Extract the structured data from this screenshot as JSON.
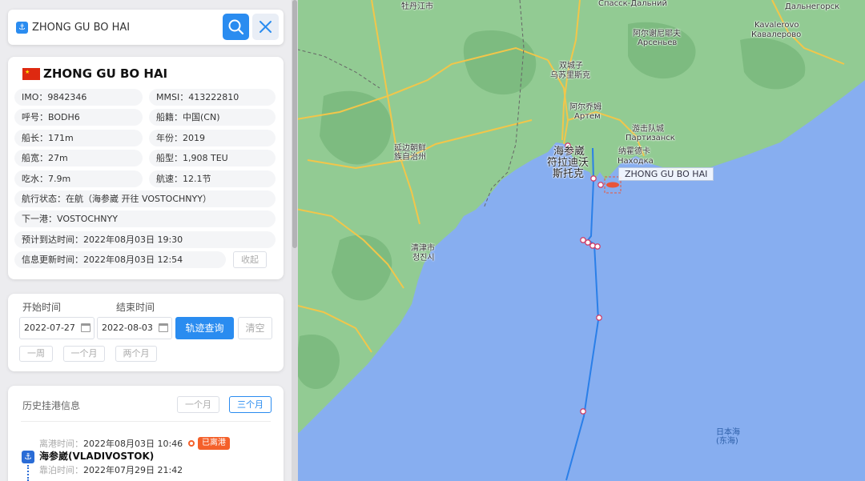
{
  "search": {
    "value": "ZHONG GU BO HAI",
    "placeholder": ""
  },
  "ship": {
    "name": "ZHONG GU BO HAI",
    "flag": "CN",
    "imo": "IMO：9842346",
    "mmsi": "MMSI：413222810",
    "callsign": "呼号：BODH6",
    "registry": "船籍：中国(CN)",
    "length": "船长：171m",
    "year": "年份：2019",
    "width": "船宽：27m",
    "type": "船型：1,908 TEU",
    "draft": "吃水：7.9m",
    "speed": "航速：12.1节",
    "status": "航行状态：在航（海参崴 开往 VOSTOCHNYY）",
    "next_port": "下一港：VOSTOCHNYY",
    "eta": "预计到达时间：2022年08月03日 19:30",
    "updated": "信息更新时间：2022年08月03日 12:54",
    "collapse_label": "收起"
  },
  "track": {
    "start_label": "开始时间",
    "end_label": "结束时间",
    "start_date": "2022-07-27",
    "end_date": "2022-08-03",
    "query_label": "轨迹查询",
    "clear_label": "清空",
    "quick": [
      "一周",
      "一个月",
      "两个月"
    ]
  },
  "history": {
    "title": "历史挂港信息",
    "one_month": "一个月",
    "three_month": "三个月",
    "entry": {
      "depart_key": "离港时间：",
      "depart_time": "2022年08月03日 10:46",
      "badge": "已离港",
      "port": "海参崴(VLADIVOSTOK)",
      "berth_key": "靠泊时间：",
      "berth_time": "2022年07月29日 21:42"
    }
  },
  "map": {
    "labels": {
      "mudanjiang": "牡丹江市",
      "spassk": "Спасск-Дальний",
      "dalnegorsk": "Дальнегорск",
      "kavalerovo_en": "Kavalerovo",
      "kavalerovo_ru": "Кавалерово",
      "arsenyev_cn": "阿尔谢尼耶夫",
      "arsenyev_ru": "Арсеньев",
      "ussuriysk_cn": "双城子",
      "ussuriysk_cn2": "乌苏里斯克",
      "artem_cn": "阿尔乔姆",
      "artem_ru": "Артем",
      "partizansk_cn": "游击队城",
      "partizansk_ru": "Партизанск",
      "nakhodka_cn": "纳霍德卡",
      "nakhodka_ru": "Находка",
      "yanbian_1": "延边朝鲜",
      "yanbian_2": "族自治州",
      "vladivostok_1": "海参崴",
      "vladivostok_2": "符拉迪沃",
      "vladivostok_3": "斯托克",
      "chongjin_1": "清津市",
      "chongjin_2": "청진시",
      "sea_1": "日本海",
      "sea_2": "(东海)"
    },
    "ship_tag": "ZHONG GU BO HAI",
    "colors": {
      "sea": "#87aef0",
      "land": "#8fc98f",
      "track": "#2a7fe8",
      "marker": "#d0406a"
    }
  }
}
